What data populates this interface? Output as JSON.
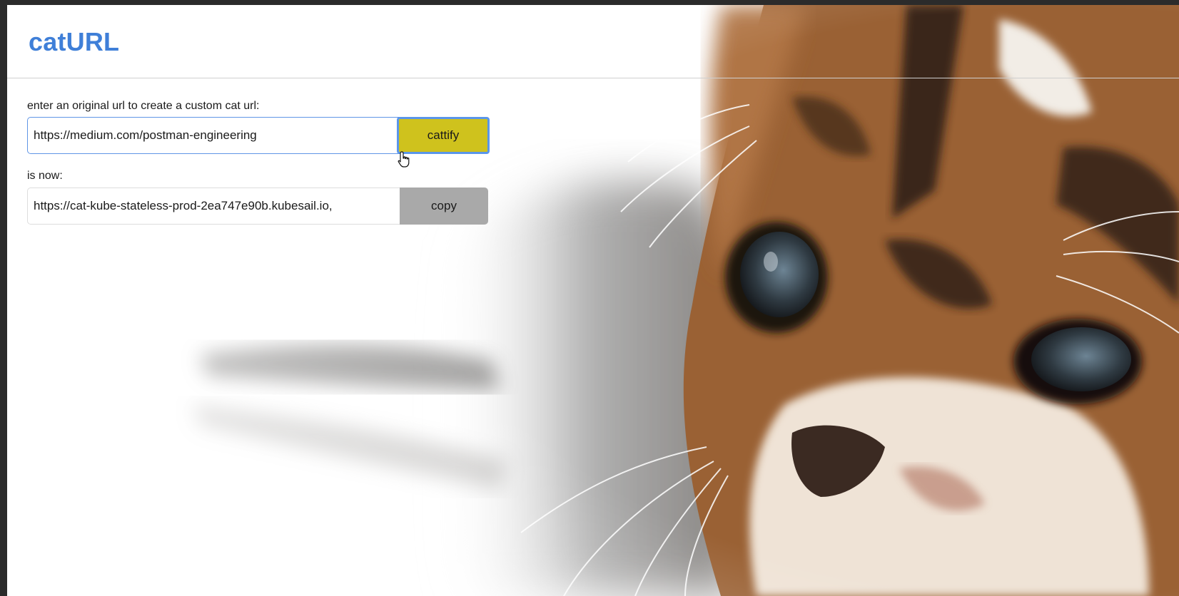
{
  "app": {
    "title": "catURL"
  },
  "form": {
    "original_label": "enter an original url to create a custom cat url:",
    "original_value": "https://medium.com/postman-engineering",
    "cattify_label": "cattify",
    "result_label": "is now:",
    "result_value": "https://cat-kube-stateless-prod-2ea747e90b.kubesail.io,",
    "copy_label": "copy"
  },
  "colors": {
    "brand": "#3f7fd8",
    "cattify_button": "#cfc21d",
    "focus_ring": "#5a96ea",
    "copy_button": "#a9a9a9",
    "window_frame": "#2b2b2b"
  },
  "icons": {
    "cursor": "hand-pointer-icon"
  }
}
